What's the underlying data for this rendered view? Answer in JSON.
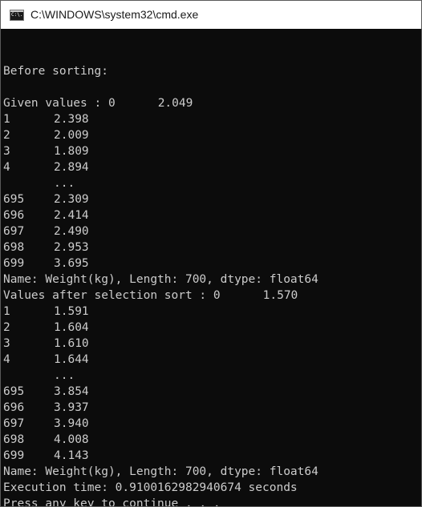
{
  "window": {
    "title": "C:\\WINDOWS\\system32\\cmd.exe",
    "icon": "cmd-icon",
    "icon_text": "C:\\."
  },
  "console": {
    "lines": [
      {
        "left": "",
        "right": ""
      },
      {
        "left": "Before sorting:",
        "right": ""
      },
      {
        "left": "",
        "right": ""
      },
      {
        "left": "Given values : 0",
        "right": "2.049",
        "wide": true
      },
      {
        "left": "1",
        "right": "2.398"
      },
      {
        "left": "2",
        "right": "2.009"
      },
      {
        "left": "3",
        "right": "1.809"
      },
      {
        "left": "4",
        "right": "2.894"
      },
      {
        "left": "",
        "right": "..."
      },
      {
        "left": "695",
        "right": "2.309"
      },
      {
        "left": "696",
        "right": "2.414"
      },
      {
        "left": "697",
        "right": "2.490"
      },
      {
        "left": "698",
        "right": "2.953"
      },
      {
        "left": "699",
        "right": "3.695"
      },
      {
        "left": "Name: Weight(kg), Length: 700, dtype: float64",
        "right": ""
      },
      {
        "left": "Values after selection sort : 0",
        "right": "1.570",
        "wide": true
      },
      {
        "left": "1",
        "right": "1.591"
      },
      {
        "left": "2",
        "right": "1.604"
      },
      {
        "left": "3",
        "right": "1.610"
      },
      {
        "left": "4",
        "right": "1.644"
      },
      {
        "left": "",
        "right": "..."
      },
      {
        "left": "695",
        "right": "3.854"
      },
      {
        "left": "696",
        "right": "3.937"
      },
      {
        "left": "697",
        "right": "3.940"
      },
      {
        "left": "698",
        "right": "4.008"
      },
      {
        "left": "699",
        "right": "4.143"
      },
      {
        "left": "Name: Weight(kg), Length: 700, dtype: float64",
        "right": ""
      },
      {
        "left": "Execution time: 0.9100162982940674 seconds",
        "right": ""
      },
      {
        "left": "Press any key to continue . . .",
        "right": ""
      }
    ]
  }
}
